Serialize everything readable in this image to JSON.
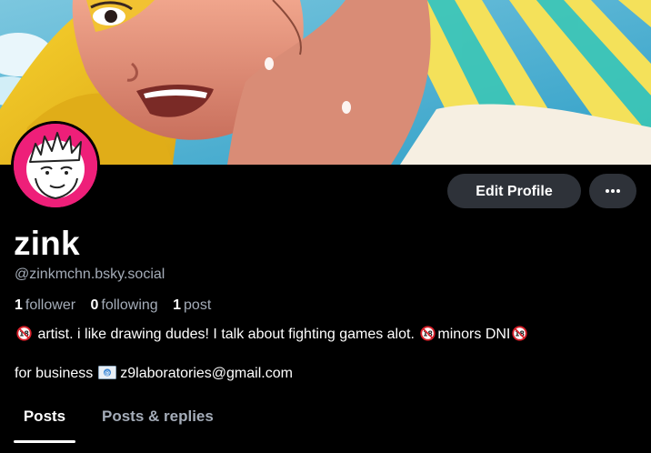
{
  "banner": {
    "description_icon": "banner-image"
  },
  "avatar": {
    "icon": "avatar",
    "ring_color": "#ee1f79"
  },
  "actions": {
    "edit_profile_label": "Edit Profile",
    "more_icon": "more-horizontal-icon"
  },
  "profile": {
    "display_name": "zink",
    "handle": "@zinkmchn.bsky.social"
  },
  "stats": {
    "followers_count": "1",
    "followers_label": "follower",
    "following_count": "0",
    "following_label": "following",
    "posts_count": "1",
    "posts_label": "post"
  },
  "bio": {
    "line1_text": "artist. i like drawing dudes! I talk about fighting games alot.",
    "line1_suffix": "minors DNI",
    "line1_emoji": "no-one-under-eighteen-icon",
    "line2_prefix": "for business",
    "line2_email": "z9laboratories@gmail.com",
    "line2_emoji": "envelope-icon"
  },
  "tabs": {
    "items": [
      {
        "label": "Posts",
        "active": true
      },
      {
        "label": "Posts & replies",
        "active": false
      }
    ]
  },
  "colors": {
    "background": "#000000",
    "button_bg": "#2e3239",
    "muted_text": "#a4acb8",
    "accent_pink": "#ee1f79"
  }
}
